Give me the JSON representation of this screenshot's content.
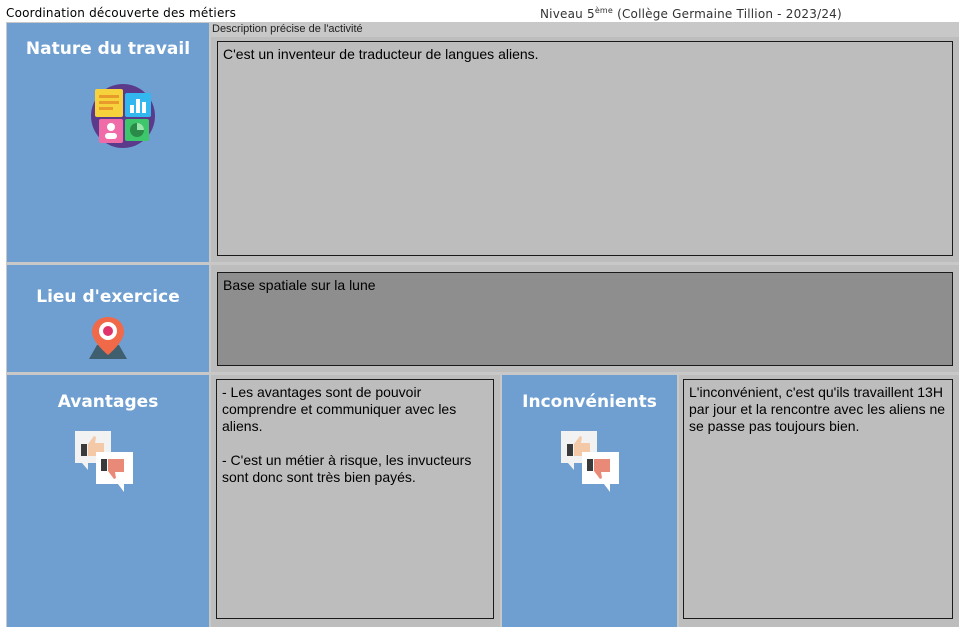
{
  "header": {
    "left_title": "Coordination découverte des métiers",
    "right_prefix": "Niveau 5",
    "right_sup": "ème",
    "right_suffix": " (Collège Germaine Tillion - 2023/24)"
  },
  "sections": {
    "nature": {
      "title": "Nature du travail",
      "sublabel": "Description précise de l'activité",
      "text": "C'est un inventeur de traducteur de langues aliens."
    },
    "lieu": {
      "title": "Lieu d'exercice",
      "text": "Base spatiale sur la lune"
    },
    "avantages": {
      "title": "Avantages",
      "text": "- Les avantages sont de pouvoir comprendre et communiquer avec les aliens.\n\n- C'est un métier à risque, les invucteurs sont donc sont très bien payés."
    },
    "inconvenients": {
      "title": "Inconvénients",
      "text": "L'inconvénient, c'est qu'ils travaillent 13H par jour et la rencontre avec les aliens ne se passe pas toujours bien."
    }
  },
  "colors": {
    "label_blue": "#6f9fd0",
    "content_gray": "#bdbdbd",
    "lieu_gray": "#8e8e8e"
  },
  "icons": {
    "nature": "dashboard-icon",
    "lieu": "map-pin-icon",
    "avantages": "thumbs-up-down-icon",
    "inconvenients": "thumbs-up-down-icon"
  }
}
